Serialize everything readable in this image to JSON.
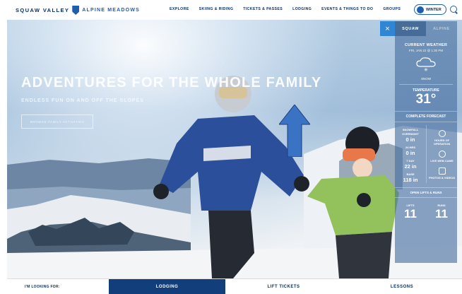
{
  "header": {
    "logo_left": "SQUAW VALLEY",
    "logo_right": "ALPINE MEADOWS",
    "nav": [
      "EXPLORE",
      "SKIING & RIDING",
      "TICKETS & PASSES",
      "LODGING",
      "EVENTS & THINGS TO DO",
      "GROUPS"
    ],
    "season": "WINTER"
  },
  "hero": {
    "title": "ADVENTURES FOR THE WHOLE FAMILY",
    "subtitle": "ENDLESS FUN ON AND OFF THE SLOPES",
    "cta": "BROWSE FAMILY ACTIVITIES"
  },
  "weather": {
    "close": "×",
    "tabs": [
      "SQUAW",
      "ALPINE"
    ],
    "current_heading": "CURRENT WEATHER",
    "date": "FRI, JAN 22 @ 1:30 PM",
    "condition": "SNOW",
    "temp_label": "TEMPERATURE",
    "temp": "31°",
    "forecast": "COMPLETE FORECAST",
    "snowfall_label": "SNOWFALL",
    "overnight_label": "OVERNIGHT",
    "overnight_val": "0 in",
    "h24_label": "24 HRS",
    "h24_val": "0 in",
    "d7_label": "7 DAY",
    "d7_val": "22 in",
    "base_label": "BASE",
    "base_val": "118 in",
    "hours_label": "HOURS OF OPERATION",
    "webcam_label": "LIVE WEB CAMS",
    "photos_label": "PHOTOS & VIDEOS",
    "open_lifts_label": "OPEN LIFTS & RUNS",
    "lifts_label": "LIFTS",
    "lifts_val": "11",
    "runs_label": "RUNS",
    "runs_val": "11"
  },
  "bottom": {
    "label": "I'M LOOKING FOR:",
    "tabs": [
      "LODGING",
      "LIFT TICKETS",
      "LESSONS"
    ]
  },
  "colors": {
    "brand": "#123e7c",
    "accent": "#2f86d4"
  }
}
